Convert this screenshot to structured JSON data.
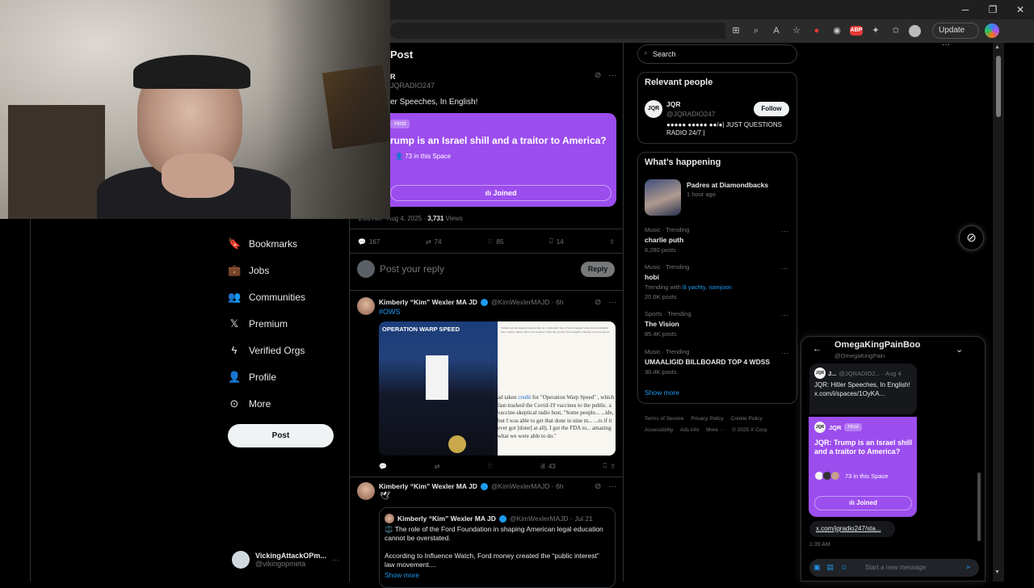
{
  "window": {
    "minimize": "─",
    "maximize": "❐",
    "close": "✕"
  },
  "browser": {
    "update_label": "Update",
    "more": "···"
  },
  "nav": {
    "items": [
      {
        "label": "Bookmarks",
        "icon": "bookmark-icon",
        "glyph": "🔖"
      },
      {
        "label": "Jobs",
        "icon": "briefcase-icon",
        "glyph": "💼"
      },
      {
        "label": "Communities",
        "icon": "people-icon",
        "glyph": "👥"
      },
      {
        "label": "Premium",
        "icon": "x-logo-icon",
        "glyph": "𝕏"
      },
      {
        "label": "Verified Orgs",
        "icon": "lightning-icon",
        "glyph": "ϟ"
      },
      {
        "label": "Profile",
        "icon": "person-icon",
        "glyph": "👤"
      },
      {
        "label": "More",
        "icon": "more-circle-icon",
        "glyph": "⊙"
      }
    ],
    "post_label": "Post",
    "account": {
      "name": "VickingAttackOPm...",
      "handle": "@vikingopmeta",
      "more": "···"
    }
  },
  "main": {
    "header": "Post",
    "op": {
      "name": "R",
      "handle": "JQRADIO247",
      "text": "er Speeches, In English!",
      "space": {
        "host_tag": "Host",
        "title": "rump is an Israel shill and a traitor to America?",
        "listening": "73 in this Space",
        "joined": "Joined"
      },
      "meta_time": "1:33 AM · Aug 4, 2025 · ",
      "views_count": "3,731",
      "views_label": " Views",
      "replies": "167",
      "reposts": "74",
      "likes": "85",
      "bookmarks": "14"
    },
    "reply": {
      "placeholder": "Post your reply",
      "button": "Reply"
    },
    "tweet1": {
      "name": "Kimberly “Kim” Wexler MA JD",
      "handle": "@KimWexlerMAJD · 6h",
      "hashtag": "#OWS",
      "photo_caption": "OPERATION WARP SPEED",
      "doc_small": "Trump was the targeted against him as a cautionary tale of what happens when the government cuts corners. Many said it was reckless when the vaccine was brought to market at record speed.",
      "doc_big_pre": "ad taken ",
      "doc_big_link": "credit",
      "doc_big_post": " for \"Operation Warp Speed\" , which fast-tracked the Covid-19 vaccines to the public. a vaccine-skeptical radio host, \"Some people... ...ide, but I was able to get that done in nine m... ...rs if it ever got [done] at all). I got the FDA to... amazing what we were able to do.\"",
      "views": "43"
    },
    "tweet2": {
      "name": "Kimberly “Kim” Wexler MA JD",
      "handle": "@KimWexlerMAJD · 6h",
      "emoji": "🕊",
      "quote": {
        "name": "Kimberly “Kim” Wexler MA JD",
        "handle": "@KimWexlerMAJD · Jul 21",
        "body1": "⚖️ The role of the Ford Foundation in shaping American legal education cannot be overstated.",
        "body2": "According to Influence Watch, Ford money created the “public interest” law movement....",
        "show_more": "Show more"
      }
    }
  },
  "sidebar": {
    "search_placeholder": "Search",
    "relevant": {
      "title": "Relevant people",
      "avatar_text": "JQR",
      "name": "JQR",
      "handle": "@JQRADIO247",
      "bio": "●●●●● ●●●●● ●●/●| JUST QUESTIONS RADIO 24/7 |",
      "follow": "Follow"
    },
    "happening": {
      "title": "What’s happening",
      "event": {
        "name": "Padres at Diamondbacks",
        "meta": "1 hour ago"
      },
      "trends": [
        {
          "cat": "Music · Trending",
          "name": "charlie puth",
          "sub": "6,280 posts"
        },
        {
          "cat": "Music · Trending",
          "name": "hobi",
          "sub_pre": "Trending with ",
          "sub_link": "lil yachty, namjoon",
          "sub": "20.6K posts"
        },
        {
          "cat": "Sports · Trending",
          "name": "The Vision",
          "sub": "85.4K posts"
        },
        {
          "cat": "Music · Trending",
          "name": "UMAALIGID BILLBOARD TOP 4 WDSS",
          "sub": "30.4K posts"
        }
      ],
      "show_more": "Show more"
    },
    "footer": [
      "Terms of Service",
      "Privacy Policy",
      "Cookie Policy",
      "Accessibility",
      "Ads info",
      "More ···",
      "© 2025 X Corp."
    ]
  },
  "dm": {
    "name": "OmegaKingPainBoo",
    "handle": "@OmegaKingPain",
    "msg1": {
      "avatar": "JQR",
      "name": "J...",
      "meta": "@JQRADIO2... · Aug 4",
      "text": "JQR: Hitler Speeches, In English! x.com/i/spaces/1OyKA..."
    },
    "space": {
      "avatar": "JQR",
      "name": "JQR",
      "host_tag": "Host",
      "title": "JQR: Trump is an Israel shill and a traitor to America?",
      "listening": "73 in this Space",
      "joined": "Joined"
    },
    "link": "x.com/jqradio247/sta...",
    "time": "1:39 AM",
    "compose_placeholder": "Start a new message"
  }
}
